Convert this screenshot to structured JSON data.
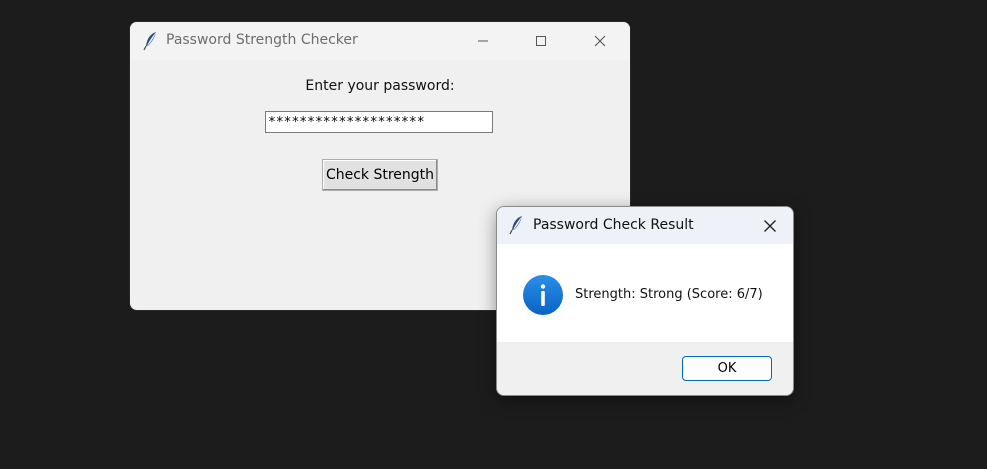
{
  "main_window": {
    "title": "Password Strength Checker",
    "prompt_label": "Enter your password:",
    "password_masked": "********************",
    "check_button_label": "Check Strength"
  },
  "dialog": {
    "title": "Password Check Result",
    "message": "Strength: Strong (Score: 6/7)",
    "ok_button_label": "OK"
  },
  "icons": {
    "app_icon": "feather-icon",
    "dialog_icon": "info-icon"
  },
  "colors": {
    "desktop_background": "#1c1c1c",
    "window_background": "#f0f0f0",
    "info_icon_blue": "#1a7fe0",
    "ok_button_border": "#0067c0"
  }
}
